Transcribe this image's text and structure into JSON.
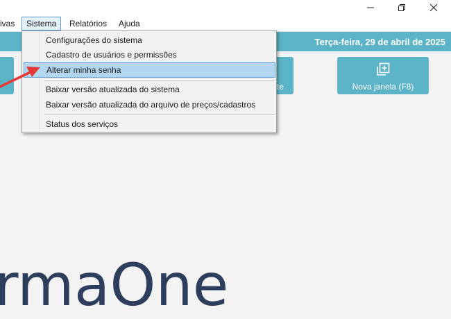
{
  "menubar": {
    "items": [
      {
        "label": "ivas"
      },
      {
        "label": "Sistema"
      },
      {
        "label": "Relatórios"
      },
      {
        "label": "Ajuda"
      }
    ]
  },
  "header": {
    "date": "Terça-feira, 29 de abril de 2025"
  },
  "tiles": {
    "partial_label": "te",
    "new_window_label": "Nova janela (F8)"
  },
  "dropdown": {
    "items": [
      {
        "label": "Configurações do sistema"
      },
      {
        "label": "Cadastro de usuários e permissões"
      },
      {
        "label": "Alterar minha senha"
      },
      {
        "label": "Baixar versão atualizada do sistema"
      },
      {
        "label": "Baixar versão atualizada do arquivo de preços/cadastros"
      },
      {
        "label": "Status dos serviços"
      }
    ],
    "highlighted_index": 2
  },
  "logo": {
    "text": "rmaOne"
  },
  "colors": {
    "accent": "#5bb3c7",
    "highlight": "#b4d7f1",
    "annotation_arrow": "#e53935",
    "logo": "#2c3e5c"
  },
  "icons": [
    "minimize-icon",
    "restore-icon",
    "close-icon",
    "new-window-icon",
    "annotation-arrow-icon"
  ]
}
